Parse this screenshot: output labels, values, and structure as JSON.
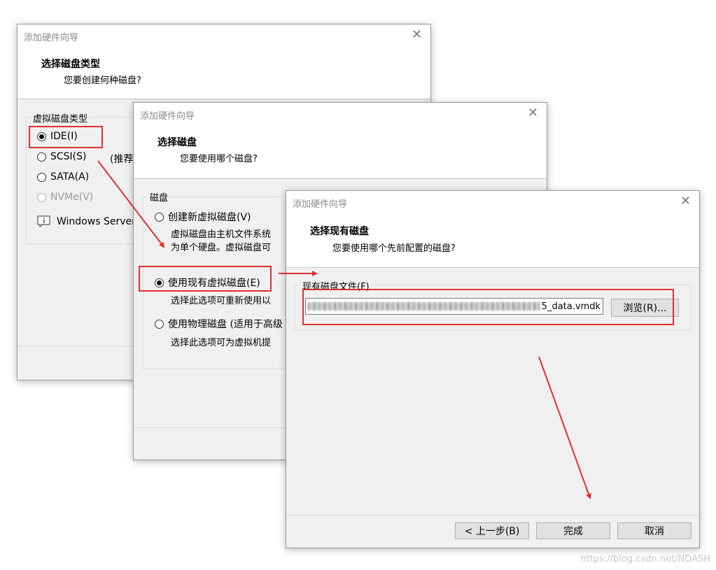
{
  "window1": {
    "title": "添加硬件向导",
    "close": "✕",
    "header_title": "选择磁盘类型",
    "header_subtitle": "您要创建何种磁盘?",
    "group_label": "虚拟磁盘类型",
    "options": [
      {
        "label": "IDE(I)",
        "selected": true,
        "disabled": false
      },
      {
        "label": "SCSI(S)",
        "selected": false,
        "disabled": false
      },
      {
        "label": "SATA(A)",
        "selected": false,
        "disabled": false
      },
      {
        "label": "NVMe(V)",
        "selected": false,
        "disabled": true
      }
    ],
    "scsi_note": "(推荐",
    "windows_server_text": "Windows Server",
    "info_icon": "info-message-icon"
  },
  "window2": {
    "title": "添加硬件向导",
    "close": "✕",
    "header_title": "选择磁盘",
    "header_subtitle": "您要使用哪个磁盘?",
    "group_label": "磁盘",
    "options": [
      {
        "label": "创建新虚拟磁盘(V)",
        "selected": false,
        "desc": [
          "虚拟磁盘由主机文件系统",
          "为单个硬盘。虚拟磁盘可"
        ]
      },
      {
        "label": "使用现有虚拟磁盘(E)",
        "selected": true,
        "desc": [
          "选择此选项可重新使用以"
        ]
      },
      {
        "label": "使用物理磁盘 (适用于高级",
        "selected": false,
        "desc": [
          "选择此选项可为虚拟机提"
        ]
      }
    ]
  },
  "window3": {
    "title": "添加硬件向导",
    "close": "✕",
    "header_title": "选择现有磁盘",
    "header_subtitle": "您要使用哪个先前配置的磁盘?",
    "file_label": "现有磁盘文件(F)",
    "file_value_suffix": "5_data.vmdk",
    "browse_label": "浏览(R)...",
    "back_label": "< 上一步(B)",
    "finish_label": "完成",
    "cancel_label": "取消"
  },
  "watermark": "https://blog.csdn.net/NDASH",
  "annotation_color": "#e03030"
}
